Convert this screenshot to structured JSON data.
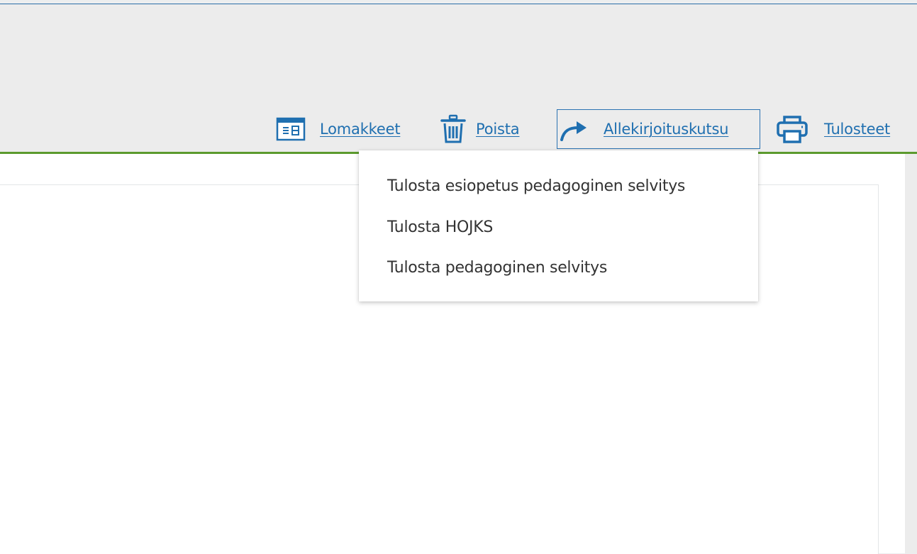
{
  "toolbar": {
    "lomakkeet": {
      "label": "Lomakkeet",
      "icon": "form-icon"
    },
    "poista": {
      "label": "Poista",
      "icon": "trash-icon"
    },
    "allekirjoituskutsu": {
      "label": "Allekirjoituskutsu",
      "icon": "share-arrow-icon"
    },
    "tulosteet": {
      "label": "Tulosteet",
      "icon": "printer-icon"
    }
  },
  "print_menu": {
    "items": [
      "Tulosta esiopetus pedagoginen selvitys",
      "Tulosta HOJKS",
      "Tulosta pedagoginen selvitys"
    ]
  },
  "colors": {
    "accent_blue": "#1f6fb0",
    "divider_green": "#5c9a2e",
    "header_bg": "#ececec",
    "menu_text": "#333333"
  }
}
